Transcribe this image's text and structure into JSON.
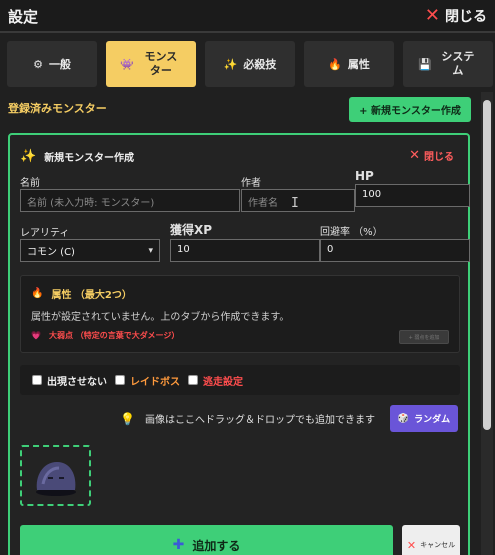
{
  "window": {
    "title": "設定",
    "close_label": "閉じる"
  },
  "tabs": [
    {
      "icon": "⚙",
      "label": "一般",
      "active": false
    },
    {
      "icon": "👾",
      "label": "モンスター",
      "active": true
    },
    {
      "icon": "✨",
      "label": "必殺技",
      "active": false
    },
    {
      "icon": "🔥",
      "label": "属性",
      "active": false
    },
    {
      "icon": "💾",
      "label": "システム",
      "active": false
    }
  ],
  "section": {
    "title": "登録済みモンスター",
    "add_button": "+ 新規モンスター作成"
  },
  "form": {
    "title": "新規モンスター作成",
    "close_label": "閉じる",
    "name": {
      "label": "名前",
      "placeholder": "名前 (未入力時: モンスター)"
    },
    "author": {
      "label": "作者",
      "placeholder": "作者名"
    },
    "hp": {
      "label": "HP",
      "value": "100"
    },
    "rarity": {
      "label": "レアリティ",
      "value": "コモン (C)"
    },
    "xp": {
      "label": "獲得XP",
      "value": "10"
    },
    "evasion": {
      "label": "回避率 （%）",
      "value": "0"
    },
    "attributes": {
      "title": "属性 （最大2つ）",
      "description": "属性が設定されていません。上のタブから作成できます。",
      "weakness": "大弱点 （特定の言葉で大ダメージ）",
      "weakness_button": "+ 弱点を追加"
    },
    "checks": {
      "hidden": "出現させない",
      "rare_boss": "レイドボス",
      "escape": "逃走設定"
    },
    "drop_hint": "画像はここへドラッグ＆ドロップでも追加できます",
    "random_button": "ランダム",
    "submit_button": "追加する",
    "cancel_button": "キャンセル"
  },
  "colors": {
    "accent_yellow": "#f5cd63",
    "accent_green": "#3ecf78",
    "danger": "#ff4d4d",
    "purple": "#6a55d8"
  }
}
